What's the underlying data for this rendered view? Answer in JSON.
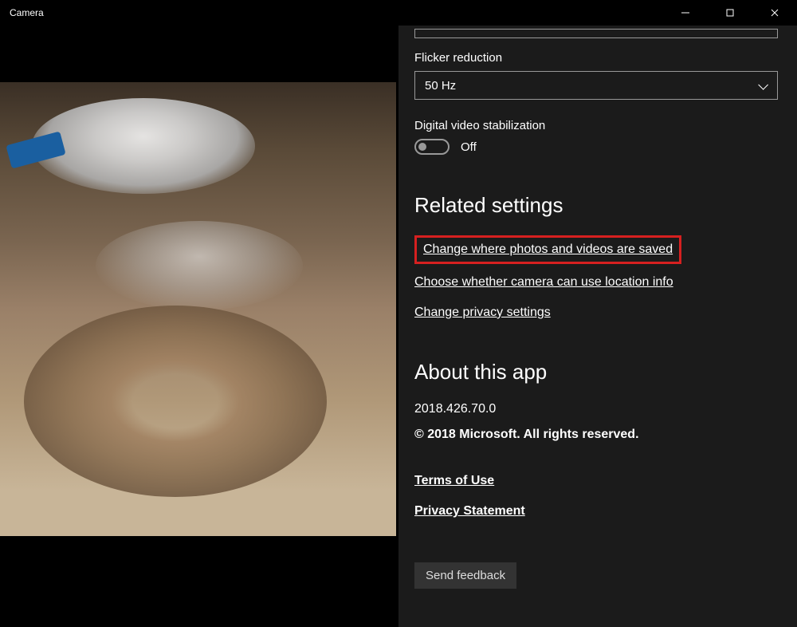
{
  "titlebar": {
    "title": "Camera"
  },
  "settings": {
    "flicker": {
      "label": "Flicker reduction",
      "value": "50 Hz"
    },
    "stabilization": {
      "label": "Digital video stabilization",
      "state": "Off"
    },
    "related": {
      "heading": "Related settings",
      "links": {
        "save_location": "Change where photos and videos are saved",
        "location_info": "Choose whether camera can use location info",
        "privacy": "Change privacy settings"
      }
    },
    "about": {
      "heading": "About this app",
      "version": "2018.426.70.0",
      "copyright": "© 2018 Microsoft. All rights reserved.",
      "terms": "Terms of Use",
      "privacy_statement": "Privacy Statement"
    },
    "feedback": {
      "label": "Send feedback"
    }
  }
}
